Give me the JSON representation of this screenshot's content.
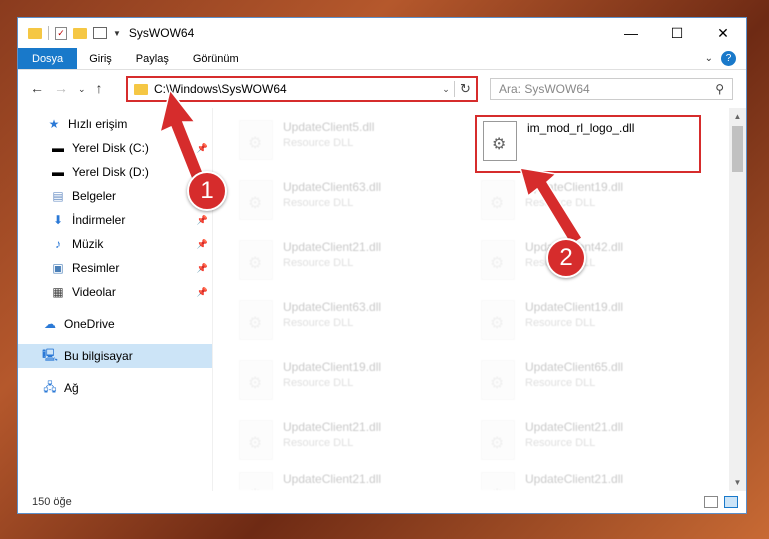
{
  "window": {
    "title": "SysWOW64"
  },
  "ribbon": {
    "tabs": [
      "Dosya",
      "Giriş",
      "Paylaş",
      "Görünüm"
    ]
  },
  "address": {
    "path": "C:\\Windows\\SysWOW64"
  },
  "search": {
    "placeholder": "Ara: SysWOW64"
  },
  "sidebar": {
    "items": [
      {
        "label": "Hızlı erişim",
        "icon": "star-icon"
      },
      {
        "label": "Yerel Disk (C:)",
        "icon": "drive-icon",
        "pinned": true
      },
      {
        "label": "Yerel Disk (D:)",
        "icon": "drive-icon"
      },
      {
        "label": "Belgeler",
        "icon": "document-icon"
      },
      {
        "label": "İndirmeler",
        "icon": "download-icon",
        "pinned": true
      },
      {
        "label": "Müzik",
        "icon": "music-icon",
        "pinned": true
      },
      {
        "label": "Resimler",
        "icon": "pictures-icon",
        "pinned": true
      },
      {
        "label": "Videolar",
        "icon": "video-icon",
        "pinned": true
      },
      {
        "label": "OneDrive",
        "icon": "cloud-icon"
      },
      {
        "label": "Bu bilgisayar",
        "icon": "computer-icon",
        "selected": true
      },
      {
        "label": "Ağ",
        "icon": "network-icon"
      }
    ]
  },
  "files": [
    {
      "name": "UpdateClient5.dll",
      "type": "Resource DLL"
    },
    {
      "name": "im_mod_rl_logo_.dll",
      "type": ""
    },
    {
      "name": "UpdateClient63.dll",
      "type": "Resource DLL"
    },
    {
      "name": "UpdateClient19.dll",
      "type": "Resource DLL"
    },
    {
      "name": "UpdateClient21.dll",
      "type": "Resource DLL"
    },
    {
      "name": "UpdateClient42.dll",
      "type": "Resource DLL"
    },
    {
      "name": "UpdateClient63.dll",
      "type": "Resource DLL"
    },
    {
      "name": "UpdateClient19.dll",
      "type": "Resource DLL"
    },
    {
      "name": "UpdateClient19.dll",
      "type": "Resource DLL"
    },
    {
      "name": "UpdateClient65.dll",
      "type": "Resource DLL"
    },
    {
      "name": "UpdateClient21.dll",
      "type": "Resource DLL"
    },
    {
      "name": "UpdateClient21.dll",
      "type": "Resource DLL"
    },
    {
      "name": "UpdateClient21.dll",
      "type": "Resource DLL"
    },
    {
      "name": "UpdateClient21.dll",
      "type": "Resource DLL"
    }
  ],
  "status": {
    "count": "150 öğe"
  },
  "annotations": {
    "step1": "1",
    "step2": "2",
    "color": "#d62c2c"
  }
}
